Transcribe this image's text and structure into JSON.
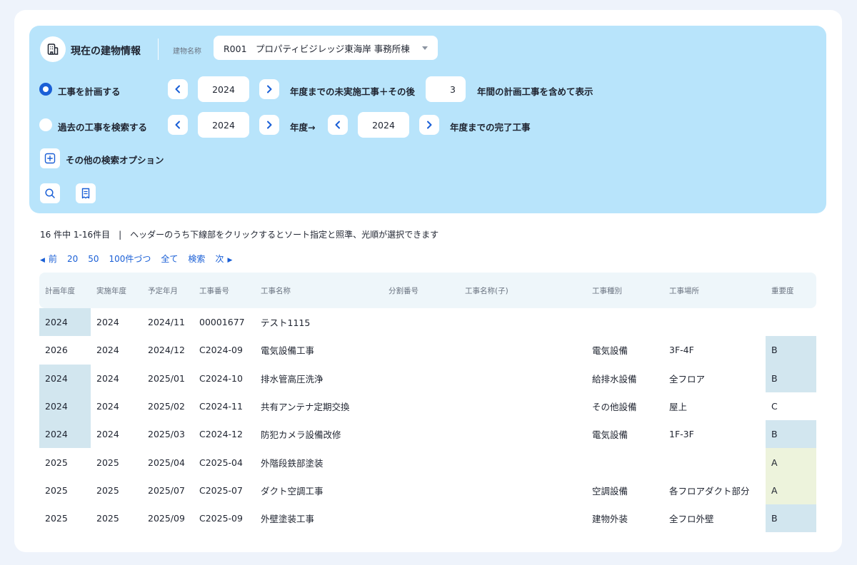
{
  "header": {
    "title": "現在の建物情報",
    "building_label": "建物名称",
    "building_value": "R001　プロパティビジレッジ東海岸 事務所棟"
  },
  "plan_row": {
    "label": "工事を計画する",
    "selected": true,
    "year": "2024",
    "text1": "年度までの未実施工事＋その後",
    "years_after": "3",
    "text2": "年間の計画工事を含めて表示"
  },
  "past_row": {
    "label": "過去の工事を検索する",
    "selected": false,
    "year_from": "2024",
    "text1": "年度→",
    "year_to": "2024",
    "text2": "年度までの完了工事"
  },
  "options": {
    "label": "その他の検索オプション"
  },
  "icons": {
    "building": "building-icon",
    "search": "search-icon",
    "receipt": "receipt-icon",
    "plus": "plus-icon",
    "prev": "chevron-left-icon",
    "next": "chevron-right-icon"
  },
  "summary": "16 件中 1-16件目　|　ヘッダーのうち下線部をクリックするとソート指定と照準、光順が選択できます",
  "pager": {
    "prev": "前",
    "sizes": [
      "20",
      "50",
      "100件づつ",
      "全て",
      "検索"
    ],
    "next": "次"
  },
  "table": {
    "headers": [
      "計画年度",
      "実施年度",
      "予定年月",
      "工事番号",
      "工事名称",
      "分割番号",
      "工事名称(子)",
      "工事種別",
      "工事場所",
      "重要度"
    ],
    "rows": [
      [
        "2024",
        "2024",
        "2024/11",
        "00001677",
        "テスト1115",
        "",
        "",
        "",
        "",
        ""
      ],
      [
        "2026",
        "2024",
        "2024/12",
        "C2024-09",
        "電気設備工事",
        "",
        "",
        "電気設備",
        "3F-4F",
        "B"
      ],
      [
        "2024",
        "2024",
        "2025/01",
        "C2024-10",
        "排水管高圧洗浄",
        "",
        "",
        "給排水設備",
        "全フロア",
        "B"
      ],
      [
        "2024",
        "2024",
        "2025/02",
        "C2024-11",
        "共有アンテナ定期交換",
        "",
        "",
        "その他設備",
        "屋上",
        "C"
      ],
      [
        "2024",
        "2024",
        "2025/03",
        "C2024-12",
        "防犯カメラ設備改修",
        "",
        "",
        "電気設備",
        "1F-3F",
        "B"
      ],
      [
        "2025",
        "2025",
        "2025/04",
        "C2025-04",
        "外階段鉄部塗装",
        "",
        "",
        "",
        "",
        "A"
      ],
      [
        "2025",
        "2025",
        "2025/07",
        "C2025-07",
        "ダクト空調工事",
        "",
        "",
        "空調設備",
        "各フロアダクト部分",
        "A"
      ],
      [
        "2025",
        "2025",
        "2025/09",
        "C2025-09",
        "外壁塗装工事",
        "",
        "",
        "建物外装",
        "全フロ外壁",
        "B"
      ]
    ]
  },
  "colors": {
    "accent": "#1a5fd6",
    "panel": "#b8e4fb",
    "highlight_plan": "#d2e6ef",
    "importance_a": "#edf3dc",
    "importance_b": "#d2e6ef"
  }
}
